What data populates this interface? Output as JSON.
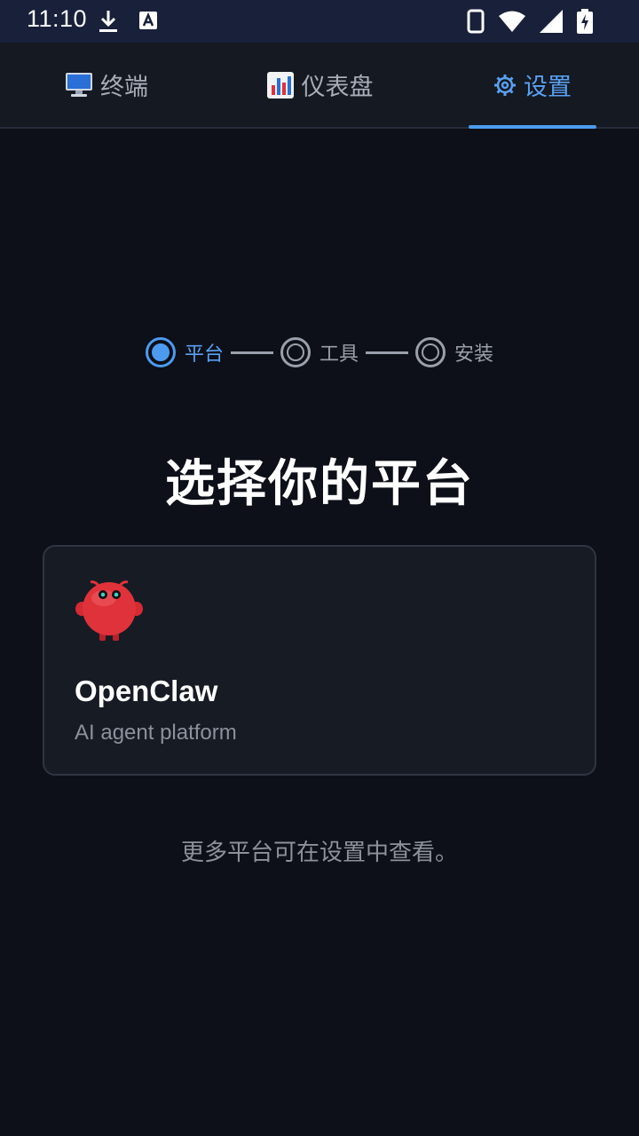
{
  "status_bar": {
    "time": "11:10"
  },
  "tabs": [
    {
      "label": "终端",
      "icon": "monitor-icon",
      "active": false
    },
    {
      "label": "仪表盘",
      "icon": "bar-chart-icon",
      "active": false
    },
    {
      "label": "设置",
      "icon": "gear-icon",
      "active": true
    }
  ],
  "stepper": {
    "steps": [
      {
        "label": "平台",
        "active": true
      },
      {
        "label": "工具",
        "active": false
      },
      {
        "label": "安装",
        "active": false
      }
    ]
  },
  "main": {
    "title": "选择你的平台",
    "footnote": "更多平台可在设置中查看。"
  },
  "platform_card": {
    "name": "OpenClaw",
    "description": "AI agent platform",
    "icon": "openclaw-mascot-icon"
  },
  "colors": {
    "accent": "#4d9bf0",
    "background": "#0d1018",
    "card_background": "#161b24",
    "mascot_red": "#e0323a"
  }
}
